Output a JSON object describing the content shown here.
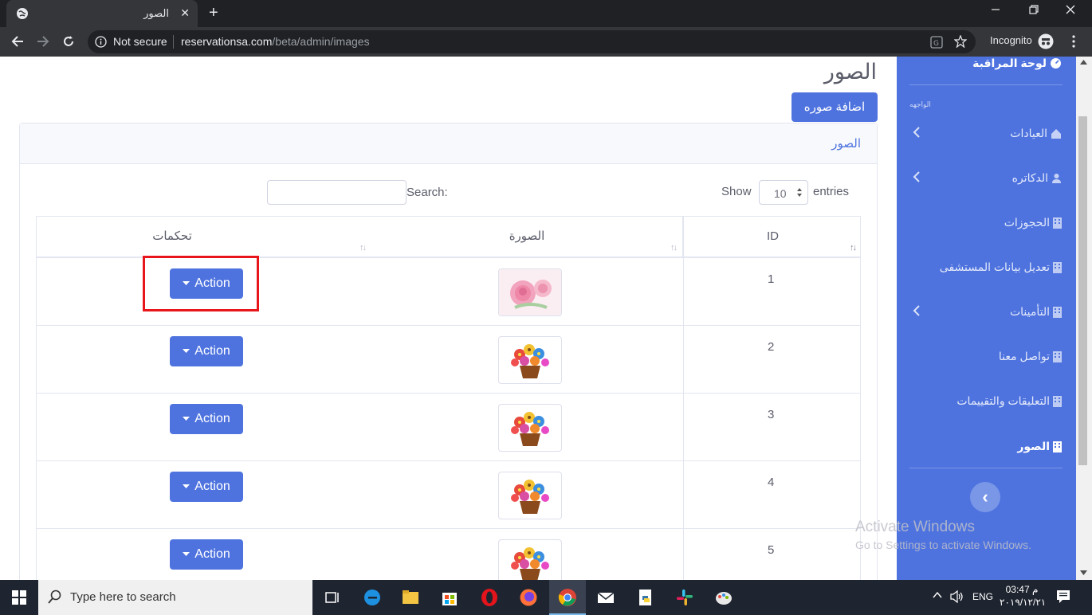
{
  "browser": {
    "tab_title": "الصور",
    "close_glyph": "✕",
    "new_tab_glyph": "+",
    "security_label": "Not secure",
    "url_host": "reservationsa.com",
    "url_path": "/beta/admin/images",
    "incognito_label": "Incognito"
  },
  "sidebar": {
    "dashboard_label": "لوحة المراقبة",
    "section_heading": "الواجهه",
    "items": [
      {
        "label": "العيادات",
        "icon": "hospital-icon",
        "has_chevron": true
      },
      {
        "label": "الدكاتره",
        "icon": "user-md-icon",
        "has_chevron": true
      },
      {
        "label": "الحجوزات",
        "icon": "building-icon",
        "has_chevron": false
      },
      {
        "label": "تعديل بيانات المستشفى",
        "icon": "building-icon",
        "has_chevron": false
      },
      {
        "label": "التأمينات",
        "icon": "building-icon",
        "has_chevron": true
      },
      {
        "label": "تواصل معنا",
        "icon": "building-icon",
        "has_chevron": false
      },
      {
        "label": "التعليقات والتقييمات",
        "icon": "building-icon",
        "has_chevron": false
      },
      {
        "label": "الصور",
        "icon": "building-icon",
        "has_chevron": false,
        "active": true
      }
    ],
    "toggle_glyph": "‹"
  },
  "main": {
    "page_title": "الصور",
    "add_button_label": "اضافة صوره",
    "card_title": "الصور"
  },
  "datatable": {
    "show_label": "Show",
    "page_length": "10",
    "entries_label": "entries",
    "search_label": "Search:",
    "columns": [
      "ID",
      "الصورة",
      "تحكمات"
    ],
    "action_label": "Action",
    "rows": [
      {
        "id": "1",
        "image": "pink-roses"
      },
      {
        "id": "2",
        "image": "flower-basket"
      },
      {
        "id": "3",
        "image": "flower-basket"
      },
      {
        "id": "4",
        "image": "flower-basket"
      },
      {
        "id": "5",
        "image": "flower-basket"
      }
    ]
  },
  "watermark": {
    "line1": "Activate Windows",
    "line2": "Go to Settings to activate Windows."
  },
  "taskbar": {
    "search_placeholder": "Type here to search",
    "language": "ENG",
    "time": "03:47 م",
    "date": "٢٠١٩/١٢/٢١"
  },
  "colors": {
    "primary": "#4e73df",
    "highlight_box": "#e8151b",
    "chrome_dark": "#202124",
    "taskbar": "#1f2530"
  }
}
